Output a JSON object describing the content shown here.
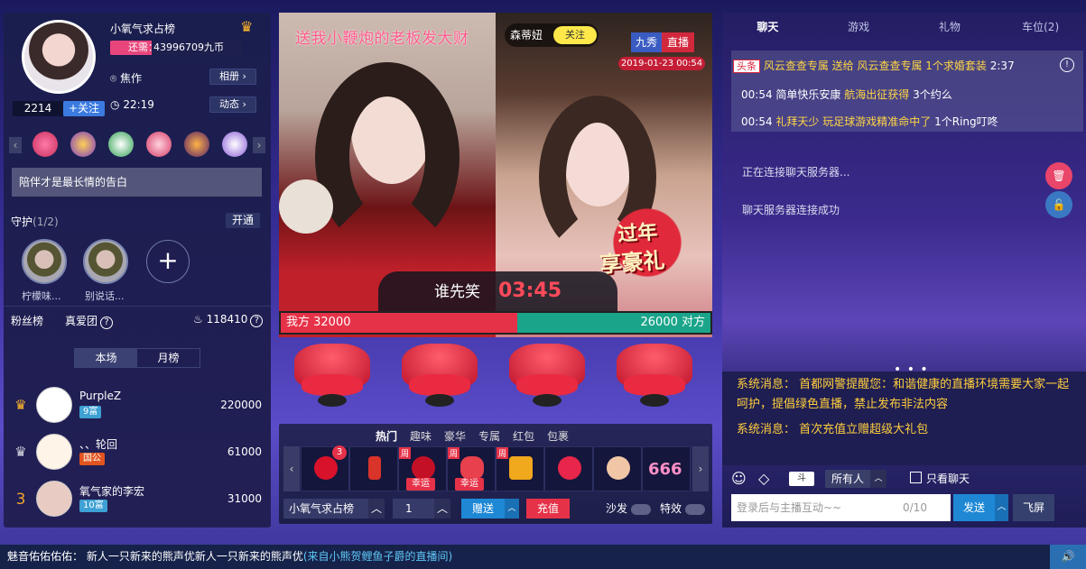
{
  "anchor_panel": {
    "rank_name": "小氧气求占榜",
    "need_label": "还需：",
    "need_value": "43996709九币",
    "location": "焦作",
    "album_btn": "相册",
    "fans_count": "2214",
    "follow_btn": "+关注",
    "live_time": "22:19",
    "dynamic_btn": "动态",
    "slogan": "陪伴才是最长情的告白",
    "guard_title": "守护",
    "guard_count": "(1/2)",
    "open_btn": "开通",
    "guards": [
      {
        "name": "柠檬味..."
      },
      {
        "name": "别说话..."
      }
    ],
    "fans_rank_label": "粉丝榜",
    "true_love_label": "真爱团",
    "heat_value": "118410",
    "rank_tabs": [
      "本场",
      "月榜"
    ],
    "ranking": [
      {
        "name": "PurpleZ",
        "level": "9富",
        "score": "220000"
      },
      {
        "name": "、、轮回",
        "level": "国公",
        "score": "61000"
      },
      {
        "rank": "3",
        "name": "氧气家的李宏",
        "level": "10富",
        "score": "31000"
      }
    ]
  },
  "stage": {
    "banner": "送我小鞭炮的老板发大财",
    "partner_name": "森蒂妞",
    "partner_follow": "关注",
    "tag_platform": "九秀",
    "tag_live": "直播",
    "date": "2019-01-23 00:54",
    "promo_line1": "过年",
    "promo_line2": "享豪礼",
    "pk_title": "谁先笑",
    "pk_timer": "03:45",
    "pk_left": "我方 32000",
    "pk_right": "26000 对方"
  },
  "gift_panel": {
    "tabs": [
      "热门",
      "趣味",
      "豪华",
      "专属",
      "红包",
      "包裹"
    ],
    "gifts": [
      {
        "badge": "3",
        "label": ""
      },
      {
        "badge": "",
        "label": ""
      },
      {
        "badge": "周",
        "label": "幸运"
      },
      {
        "badge": "周",
        "label": "幸运"
      },
      {
        "badge": "周",
        "label": ""
      },
      {
        "badge": "",
        "label": ""
      },
      {
        "badge": "",
        "label": ""
      },
      {
        "badge": "",
        "label": ""
      }
    ],
    "recipient": "小氧气求占榜",
    "quantity": "1",
    "give_btn": "赠送",
    "recharge_btn": "充值",
    "sofa_label": "沙发",
    "effect_label": "特效"
  },
  "chat_panel": {
    "tabs": [
      "聊天",
      "游戏",
      "礼物",
      "车位(2)"
    ],
    "headline_tag": "头条",
    "headline": "风云查查专属 送给 风云查查专属 1个求婚套装",
    "headline_time": "2:37",
    "msg1_time": "00:54",
    "msg1_user": "简单快乐安康",
    "msg1_text": "航海出征获得",
    "msg1_tail": "3个约么",
    "msg2_time": "00:54",
    "msg2_user": "礼拜天少",
    "msg2_text": "玩足球游戏精准命中了",
    "msg2_tail": "1个Ring叮咚",
    "conn1": "正在连接聊天服务器...",
    "conn2": "聊天服务器连接成功",
    "sys1_label": "系统消息：",
    "sys1_text": "首都网警提醒您：和谐健康的直播环境需要大家一起呵护，提倡绿色直播，禁止发布非法内容",
    "sys2_label": "系统消息：",
    "sys2_text": "首次充值立赠超级大礼包",
    "target": "所有人",
    "only_chat": "只看聊天",
    "input_placeholder": "登录后与主播互动~~",
    "counter": "0/10",
    "send_btn": "发送",
    "fly_btn": "飞屏"
  },
  "footer": {
    "prefix": "魅音佑佑佑佑：",
    "text": "新人一只新来的熊声优新人一只新来的熊声优",
    "source": "(来自小熊贺鲤鱼子爵的直播间)"
  }
}
